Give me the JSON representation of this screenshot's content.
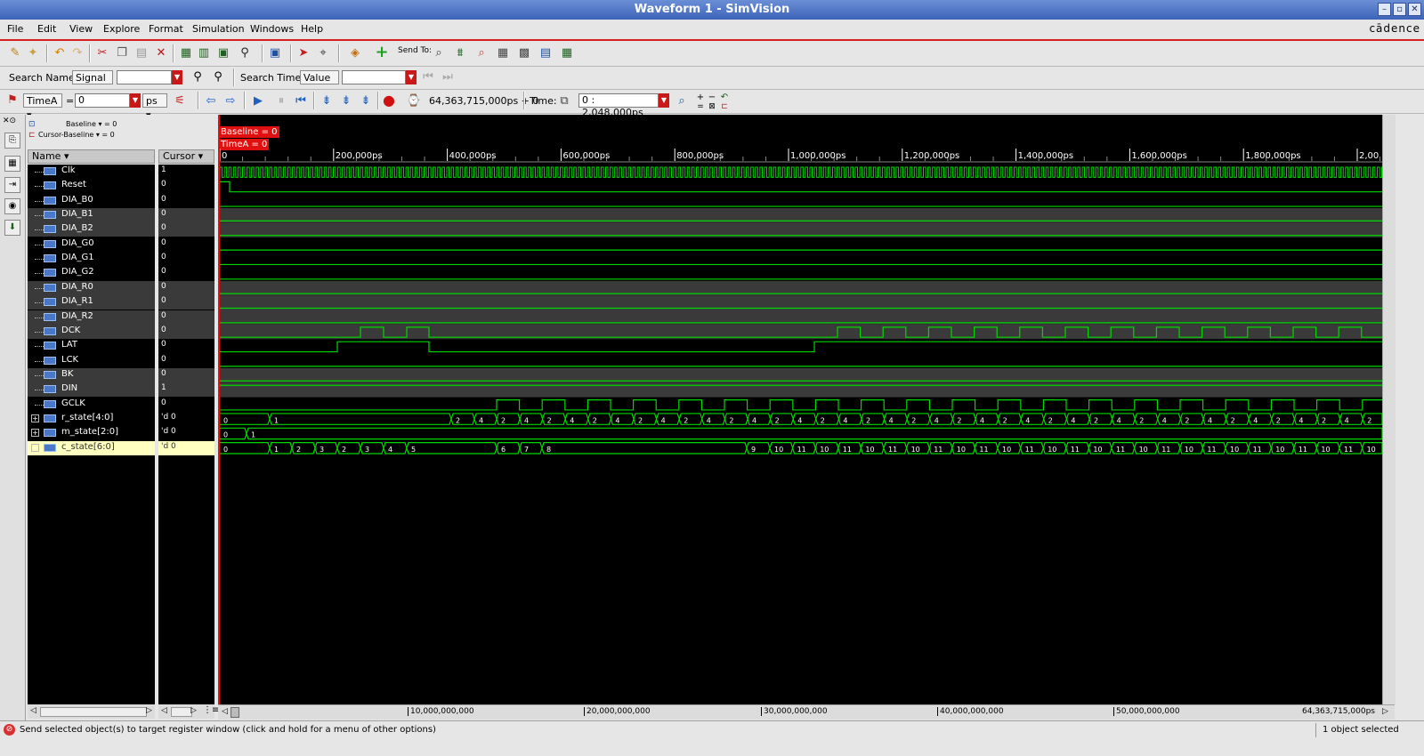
{
  "window": {
    "title": "Waveform 1 - SimVision"
  },
  "menu": {
    "items": [
      "File",
      "Edit",
      "View",
      "Explore",
      "Format",
      "Simulation",
      "Windows",
      "Help"
    ],
    "brand": "cādence"
  },
  "toolbar": {
    "send_to_label": "Send To:"
  },
  "search": {
    "names_label": "Search Names:",
    "names_type": "Signal",
    "names_value": "",
    "times_label": "Search Times:",
    "times_type": "Value",
    "times_value": ""
  },
  "cursorbar": {
    "cursor_name": "TimeA",
    "equals": "=",
    "cursor_value": "0",
    "unit": "ps",
    "sim_time": "64,363,715,000ps + 0",
    "time_label": "Time:",
    "time_range": "0 : 2,048,000ps"
  },
  "info": {
    "baseline": "Baseline ▾ = 0",
    "cursor_baseline": "Cursor-Baseline ▾ = 0"
  },
  "markers": {
    "baseline": "Baseline = 0",
    "timea": "TimeA = 0"
  },
  "columns": {
    "name": "Name ▾",
    "cursor": "Cursor ▾"
  },
  "signals": [
    {
      "name": "Clk",
      "value": "1"
    },
    {
      "name": "Reset",
      "value": "0"
    },
    {
      "name": "DIA_B0",
      "value": "0"
    },
    {
      "name": "DIA_B1",
      "value": "0"
    },
    {
      "name": "DIA_B2",
      "value": "0"
    },
    {
      "name": "DIA_G0",
      "value": "0"
    },
    {
      "name": "DIA_G1",
      "value": "0"
    },
    {
      "name": "DIA_G2",
      "value": "0"
    },
    {
      "name": "DIA_R0",
      "value": "0"
    },
    {
      "name": "DIA_R1",
      "value": "0"
    },
    {
      "name": "DIA_R2",
      "value": "0"
    },
    {
      "name": "DCK",
      "value": "0"
    },
    {
      "name": "LAT",
      "value": "0"
    },
    {
      "name": "LCK",
      "value": "0"
    },
    {
      "name": "BK",
      "value": "0"
    },
    {
      "name": "DIN",
      "value": "1"
    },
    {
      "name": "GCLK",
      "value": "0"
    },
    {
      "name": "r_state[4:0]",
      "value": "'d 0"
    },
    {
      "name": "m_state[2:0]",
      "value": "'d 0"
    },
    {
      "name": "c_state[6:0]",
      "value": "'d 0"
    }
  ],
  "timeline": {
    "ticks": [
      "0",
      "200,000ps",
      "400,000ps",
      "600,000ps",
      "800,000ps",
      "1,000,000ps",
      "1,200,000ps",
      "1,400,000ps",
      "1,600,000ps",
      "1,800,000ps",
      "2,00"
    ]
  },
  "overview": {
    "ticks": [
      "10,000,000,000",
      "20,000,000,000",
      "30,000,000,000",
      "40,000,000,000",
      "50,000,000,000"
    ],
    "end": "64,363,715,000ps"
  },
  "status": {
    "message": "Send selected object(s) to target register window (click and hold for a menu of other options)",
    "selection": "1 object selected"
  },
  "colors": {
    "wave": "#00d800",
    "marker": "#e01010",
    "background": "#000000"
  }
}
